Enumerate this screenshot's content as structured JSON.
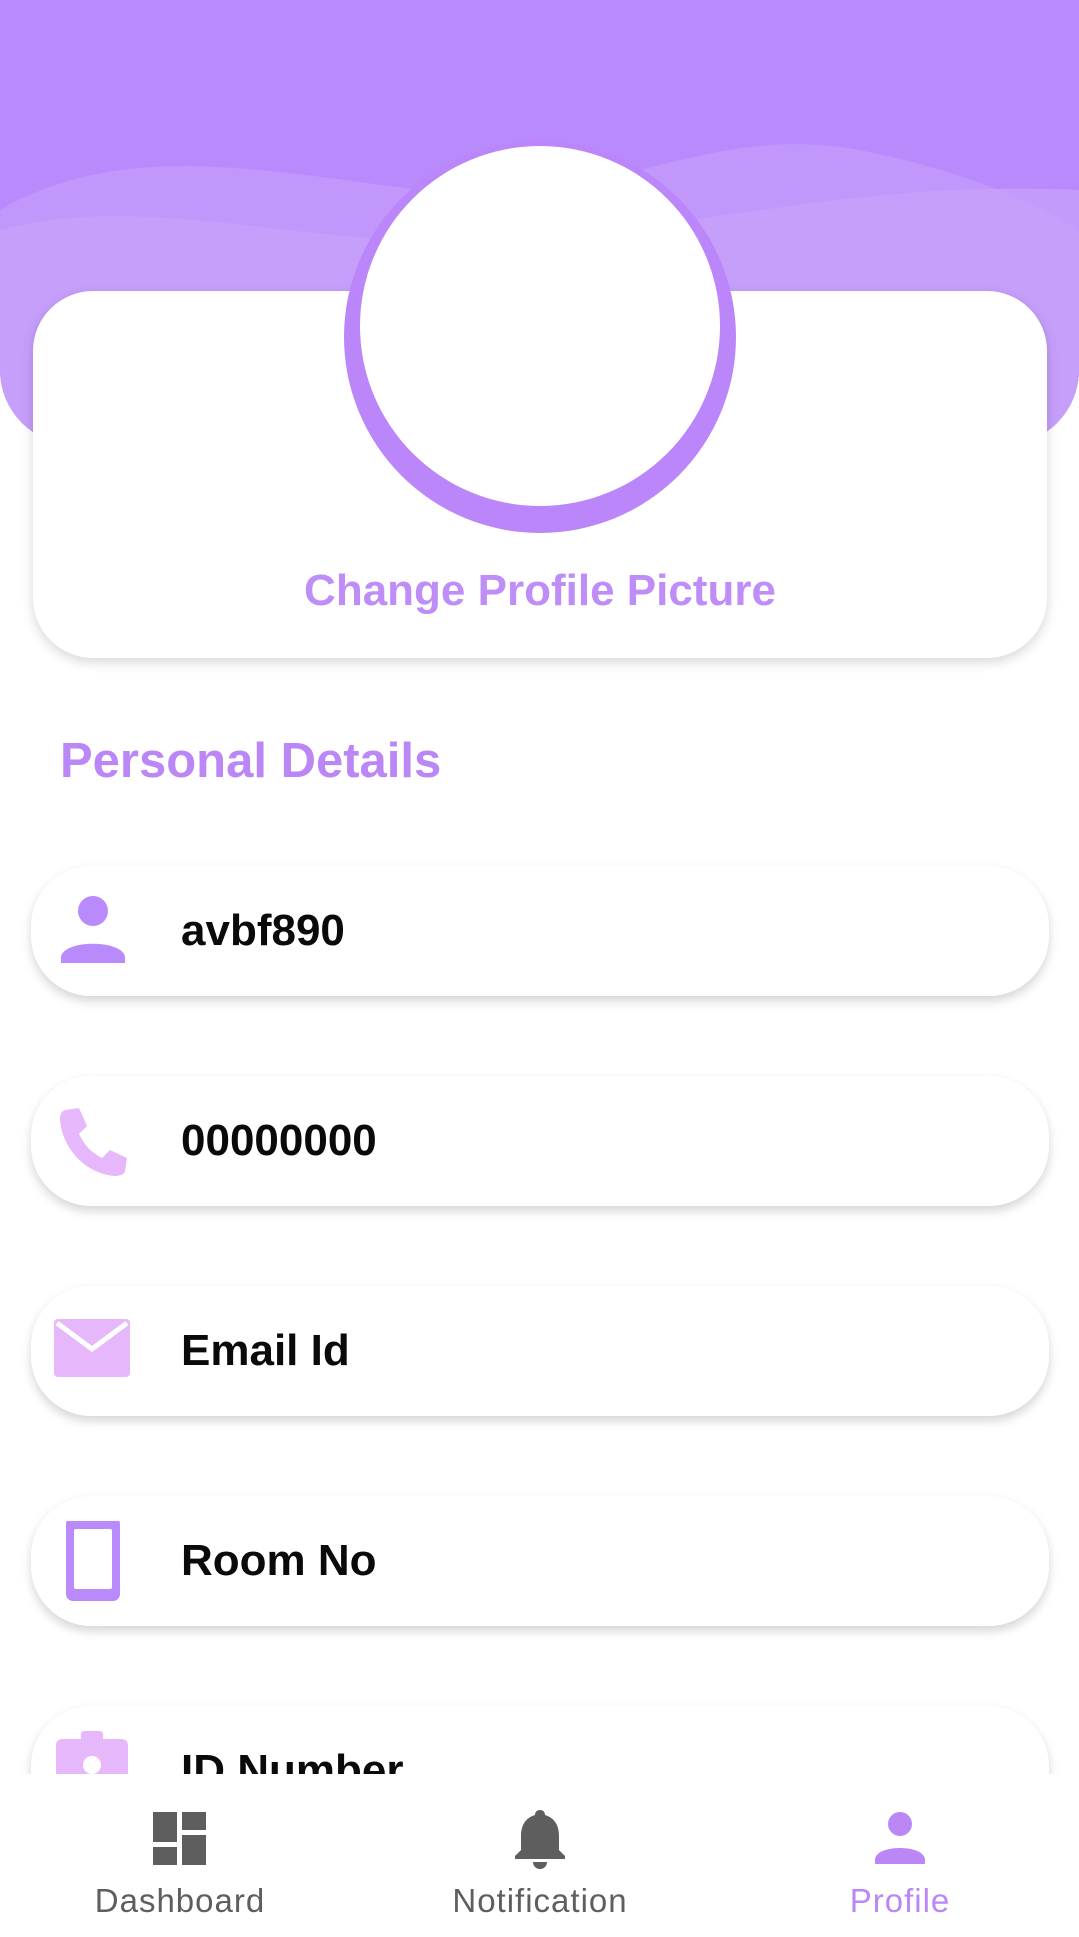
{
  "colors": {
    "primary": "#b98afc",
    "accent_text": "#bb86f6",
    "icon_light": "#e6b8fb",
    "nav_inactive": "#5e5e5e"
  },
  "profile": {
    "change_picture_label": "Change Profile Picture"
  },
  "section": {
    "title": "Personal Details"
  },
  "fields": [
    {
      "icon": "person-icon",
      "value": "avbf890"
    },
    {
      "icon": "phone-icon",
      "value": "00000000"
    },
    {
      "icon": "mail-icon",
      "value": "Email Id"
    },
    {
      "icon": "tablet-icon",
      "value": "Room No"
    },
    {
      "icon": "id-badge-icon",
      "value": "ID Number"
    }
  ],
  "nav": {
    "items": [
      {
        "label": "Dashboard",
        "icon": "dashboard-icon",
        "active": false
      },
      {
        "label": "Notification",
        "icon": "bell-icon",
        "active": false
      },
      {
        "label": "Profile",
        "icon": "person-icon",
        "active": true
      }
    ]
  }
}
